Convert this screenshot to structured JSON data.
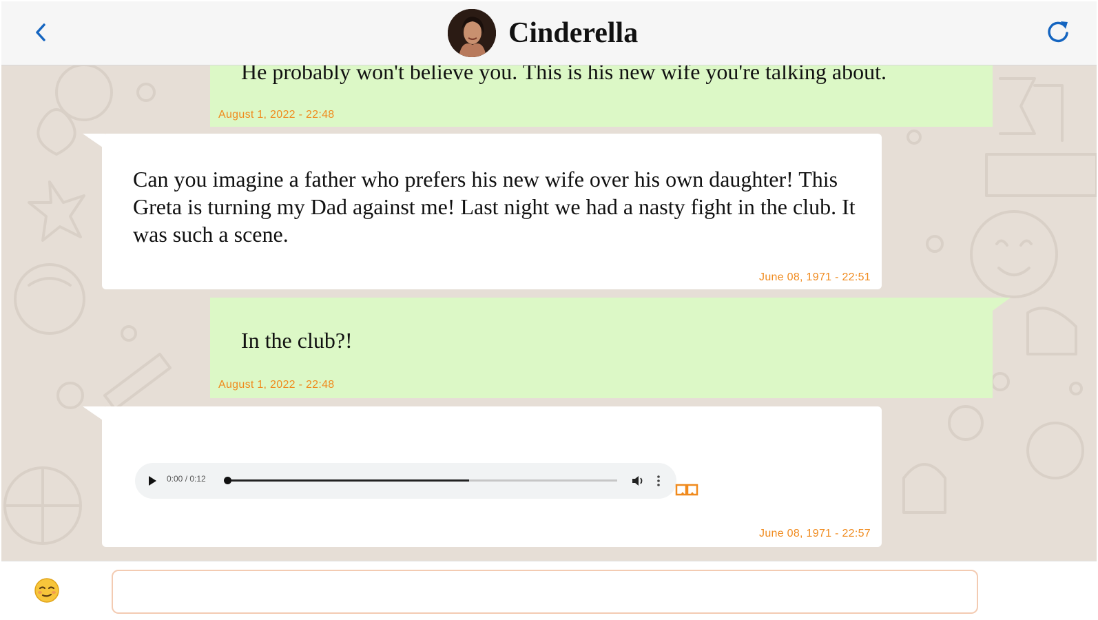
{
  "header": {
    "contact_name": "Cinderella",
    "back_icon": "chevron-left-icon",
    "refresh_icon": "refresh-icon",
    "accent_color": "#1565c0"
  },
  "messages": [
    {
      "direction": "sent",
      "text": "He probably won't believe you. This is his new wife you're talking about.",
      "time": "August 1, 2022 - 22:48"
    },
    {
      "direction": "received",
      "text": "Can you imagine a father who prefers his new wife over his own daughter! This Greta is turning my Dad against me! Last night we had a nasty fight in the club. It was such a scene.",
      "time": "June 08, 1971 - 22:51"
    },
    {
      "direction": "sent",
      "text": "In the club?!",
      "time": "August 1, 2022 - 22:48"
    },
    {
      "direction": "received",
      "type": "audio",
      "audio": {
        "time": "0:00 / 0:12",
        "progress": 0.62
      },
      "time": "June 08, 1971 - 22:57"
    }
  ],
  "footer": {
    "emoji_icon": "smiley-emoji-icon",
    "input_value": "",
    "input_placeholder": ""
  },
  "colors": {
    "sent_bubble": "#dcf8c6",
    "received_bubble": "#ffffff",
    "timestamp": "#f08a1d",
    "chat_background": "#e6ded6"
  }
}
